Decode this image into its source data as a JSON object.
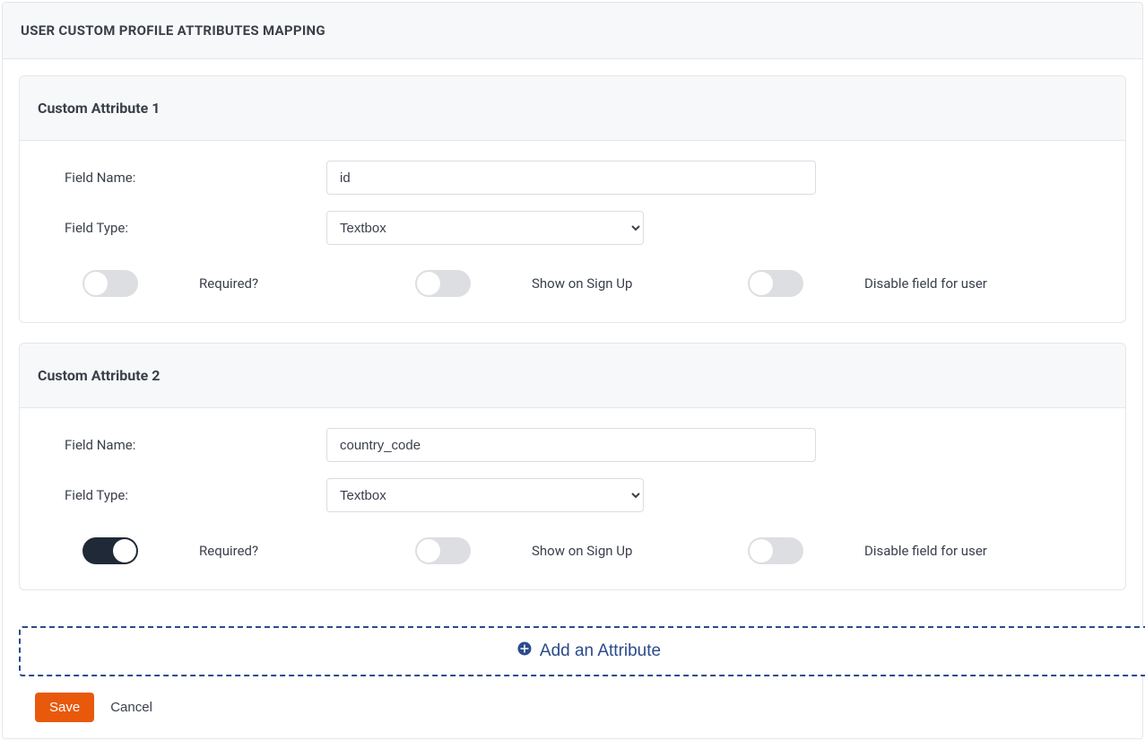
{
  "panel": {
    "title": "USER CUSTOM PROFILE ATTRIBUTES MAPPING"
  },
  "attributes": [
    {
      "title": "Custom Attribute 1",
      "field_name_label": "Field Name:",
      "field_name_value": "id",
      "field_type_label": "Field Type:",
      "field_type_value": "Textbox",
      "toggles": {
        "required_label": "Required?",
        "required_on": false,
        "show_signup_label": "Show on Sign Up",
        "show_signup_on": false,
        "disable_label": "Disable field for user",
        "disable_on": false
      }
    },
    {
      "title": "Custom Attribute 2",
      "field_name_label": "Field Name:",
      "field_name_value": "country_code",
      "field_type_label": "Field Type:",
      "field_type_value": "Textbox",
      "toggles": {
        "required_label": "Required?",
        "required_on": true,
        "show_signup_label": "Show on Sign Up",
        "show_signup_on": false,
        "disable_label": "Disable field for user",
        "disable_on": false
      }
    }
  ],
  "add_attribute_label": "Add an Attribute",
  "actions": {
    "save": "Save",
    "cancel": "Cancel"
  },
  "field_type_options": [
    "Textbox"
  ]
}
